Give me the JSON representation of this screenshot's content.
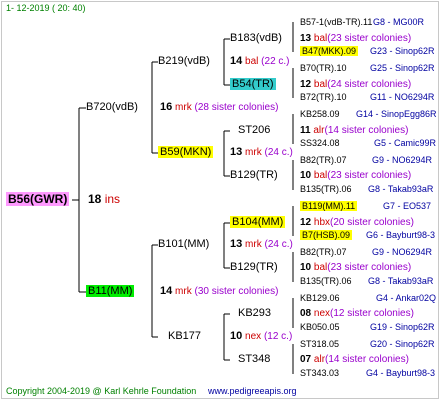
{
  "header": {
    "date": "1-  12-2019  (  20:  40)"
  },
  "footer": {
    "copyright": "Copyright 2004-2019 @ Karl Kehrle Foundation",
    "website": "www.pedigreeapis.org"
  },
  "root": {
    "id": "B56(GWR)",
    "gen_num": "18",
    "gen_mark": "ins"
  },
  "gen1": [
    {
      "id": "B720(vdB)",
      "num": "16",
      "mark": "mrk",
      "note": "(28 sister colonies)"
    },
    {
      "id": "B11(MM)",
      "num": "14",
      "mark": "mrk",
      "note": "(30 sister colonies)"
    }
  ],
  "gen2": [
    {
      "id": "B219(vdB)",
      "num": "14",
      "mark": "bal",
      "note": "(22 c.)"
    },
    {
      "id": "B59(MKN)",
      "num": "13",
      "mark": "mrk",
      "note": "(24 c.)"
    },
    {
      "id": "B101(MM)",
      "num": "13",
      "mark": "mrk",
      "note": "(24 c.)"
    },
    {
      "id": "KB177",
      "num": "10",
      "mark": "nex",
      "note": "(12 c.)"
    }
  ],
  "gen3": [
    {
      "id": "B183(vdB)",
      "num": "13",
      "mark": "bal",
      "note": "(23 sister colonies)"
    },
    {
      "id": "B54(TR)",
      "num": "12",
      "mark": "bal",
      "note": "(24 sister colonies)"
    },
    {
      "id": "ST206",
      "num": "11",
      "mark": "alr",
      "note": "(14 sister colonies)"
    },
    {
      "id": "B129(TR)",
      "num": "10",
      "mark": "bal",
      "note": "(23 sister colonies)"
    },
    {
      "id": "B104(MM)",
      "num": "12",
      "mark": "hbx",
      "note": "(20 sister colonies)"
    },
    {
      "id": "B129(TR)",
      "num": "10",
      "mark": "bal",
      "note": "(23 sister colonies)"
    },
    {
      "id": "KB293",
      "num": "08",
      "mark": "nex",
      "note": "(12 sister colonies)"
    },
    {
      "id": "ST348",
      "num": "07",
      "mark": "alr",
      "note": "(14 sister colonies)"
    }
  ],
  "gen4": [
    {
      "id": "B57-1(vdB-TR).11",
      "code": "G8 - MG00R"
    },
    {
      "id": "B47(MKK).09",
      "code": "G23 - Sinop62R"
    },
    {
      "id": "B70(TR).10",
      "code": "G25 - Sinop62R"
    },
    {
      "id": "B72(TR).10",
      "code": "G11 - NO6294R"
    },
    {
      "id": "KB258.09",
      "code": "G14 - SinopEgg86R"
    },
    {
      "id": "SS324.08",
      "code": "G5 - Camic99R"
    },
    {
      "id": "B82(TR).07",
      "code": "G9 - NO6294R"
    },
    {
      "id": "B135(TR).06",
      "code": "G8 - Takab93aR"
    },
    {
      "id": "B119(MM).11",
      "code": "G7 - EO537"
    },
    {
      "id": "B7(HSB).09",
      "code": "G6 - Bayburt98-3"
    },
    {
      "id": "B82(TR).07",
      "code": "G9 - NO6294R"
    },
    {
      "id": "B135(TR).06",
      "code": "G8 - Takab93aR"
    },
    {
      "id": "KB129.06",
      "code": "G4 - Ankar02Q"
    },
    {
      "id": "KB050.05",
      "code": "G19 - Sinop62R"
    },
    {
      "id": "ST318.05",
      "code": "G20 - Sinop62R"
    },
    {
      "id": "ST343.03",
      "code": "G4 - Bayburt98-3"
    }
  ]
}
